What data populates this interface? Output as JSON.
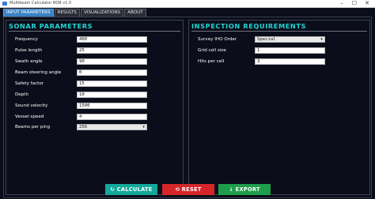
{
  "window": {
    "title": "Multibeam Calculator BOB v1.0"
  },
  "tabs": [
    {
      "label": "Input Parameters",
      "active": true
    },
    {
      "label": "Results",
      "active": false
    },
    {
      "label": "Visualizations",
      "active": false
    },
    {
      "label": "About",
      "active": false
    }
  ],
  "sonar": {
    "title": "SONAR PARAMETERS",
    "fields": [
      {
        "label": "Frequency",
        "value": "400"
      },
      {
        "label": "Pulse length",
        "value": "25"
      },
      {
        "label": "Swath angle",
        "value": "90"
      },
      {
        "label": "Beam steering angle",
        "value": "0"
      },
      {
        "label": "Safety factor",
        "value": "15"
      },
      {
        "label": "Depth",
        "value": "10"
      },
      {
        "label": "Sound velocity",
        "value": "1500"
      },
      {
        "label": "Vessel speed",
        "value": "4"
      },
      {
        "label": "Beams per ping",
        "value": "256"
      }
    ]
  },
  "inspection": {
    "title": "INSPECTION REQUIREMENTS",
    "fields": [
      {
        "label": "Survey IHO Order",
        "value": "Special"
      },
      {
        "label": "Grid cell size",
        "value": "1"
      },
      {
        "label": "Hits per cell",
        "value": "3"
      }
    ]
  },
  "buttons": {
    "calculate": {
      "label": "↻ CALCULATE",
      "color": "#12a89a"
    },
    "reset": {
      "label": "⟲ RESET",
      "color": "#d6262a"
    },
    "export": {
      "label": "↓ EXPORT",
      "color": "#1e9e4a"
    }
  },
  "colors": {
    "accent": "#22d6d6",
    "background": "#0b0e1a",
    "tab_active": "#3b82c4"
  }
}
